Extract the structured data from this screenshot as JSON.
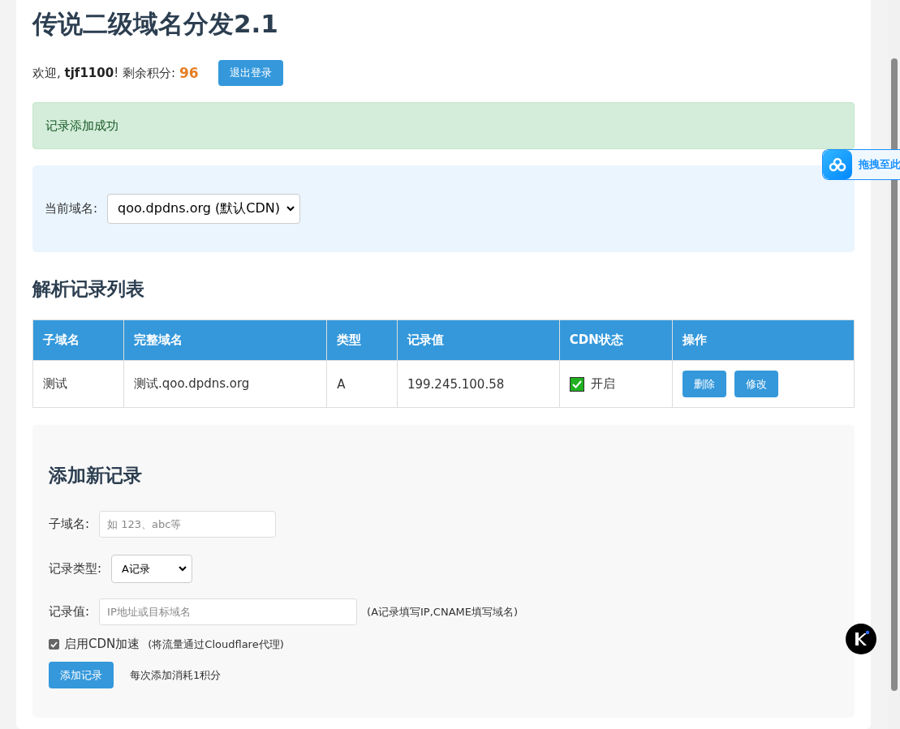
{
  "title": "传说二级域名分发2.1",
  "user": {
    "greeting": "欢迎,",
    "username": "tjf1100",
    "exclaim": "!",
    "points_label": "剩余积分:",
    "points": "96",
    "logout": "退出登录"
  },
  "alert": {
    "message": "记录添加成功"
  },
  "domain": {
    "label": "当前域名:",
    "value": "qoo.dpdns.org (默认CDN)"
  },
  "records": {
    "heading": "解析记录列表",
    "columns": [
      "子域名",
      "完整域名",
      "类型",
      "记录值",
      "CDN状态",
      "操作"
    ],
    "rows": [
      {
        "subdomain": "测试",
        "full": "测试.qoo.dpdns.org",
        "type": "A",
        "value": "199.245.100.58",
        "cdn_on": true,
        "cdn_text": "开启",
        "actions": [
          "删除",
          "修改"
        ]
      }
    ]
  },
  "add_form": {
    "heading": "添加新记录",
    "subdomain": {
      "label": "子域名:",
      "placeholder": "如 123、abc等"
    },
    "type": {
      "label": "记录类型:",
      "value": "A记录"
    },
    "value": {
      "label": "记录值:",
      "placeholder": "IP地址或目标域名",
      "hint": "(A记录填写IP,CNAME填写域名)"
    },
    "cdn": {
      "label": "启用CDN加速",
      "hint": "(将流量通过Cloudflare代理)",
      "checked": true
    },
    "submit": "添加记录",
    "cost_note": "每次添加消耗1积分"
  },
  "drop_widget": {
    "label": "拖拽至此"
  }
}
